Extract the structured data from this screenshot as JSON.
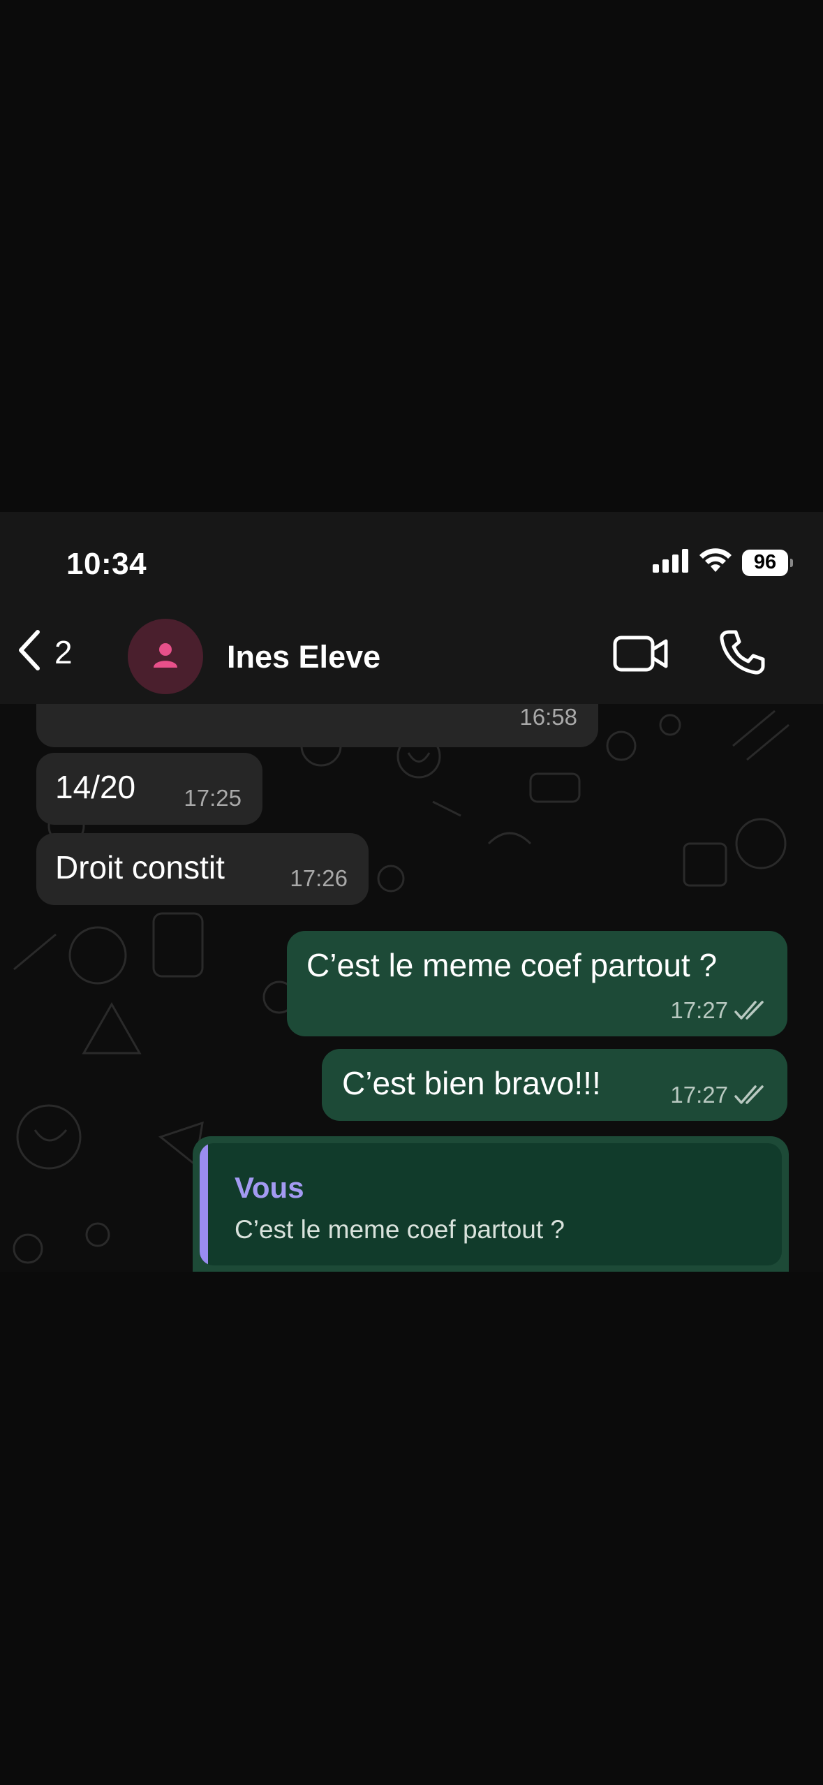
{
  "status_bar": {
    "time": "10:34",
    "battery": "96"
  },
  "header": {
    "back_count": "2",
    "contact_name": "Ines Eleve",
    "icons": {
      "back": "chevron-left-icon",
      "avatar": "person-icon",
      "video": "video-camera-icon",
      "call": "phone-icon"
    },
    "avatar_color": "#e8508a"
  },
  "messages": [
    {
      "direction": "in",
      "text": "",
      "time": "16:58"
    },
    {
      "direction": "in",
      "text": "14/20",
      "time": "17:25"
    },
    {
      "direction": "in",
      "text": "Droit constit",
      "time": "17:26"
    },
    {
      "direction": "out",
      "text": "C’est le meme coef partout ?",
      "time": "17:27",
      "read": true
    },
    {
      "direction": "out",
      "text": "C’est bien bravo!!!",
      "time": "17:27",
      "read": true
    }
  ],
  "reply": {
    "author": "Vous",
    "quoted_text": "C’est le meme coef partout ?"
  },
  "colors": {
    "incoming_bubble": "#262626",
    "outgoing_bubble": "#1d4a37",
    "quote_accent": "#9a8cf0"
  }
}
